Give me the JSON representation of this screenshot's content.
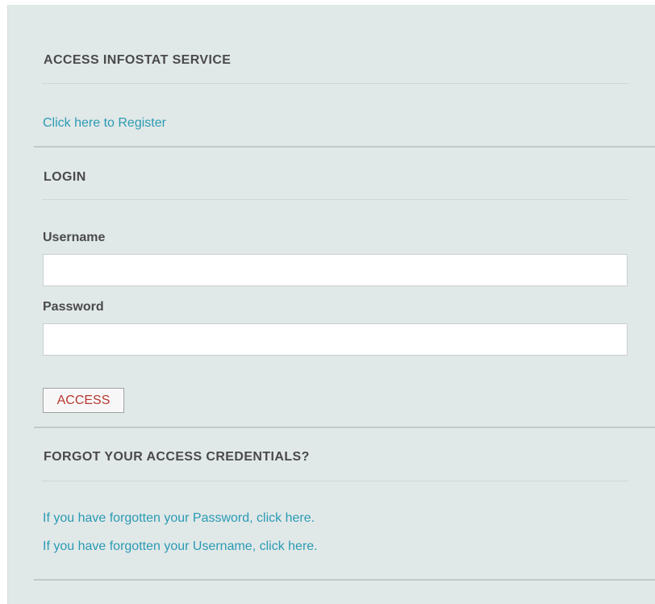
{
  "service_section": {
    "title": "ACCESS INFOSTAT SERVICE",
    "register_link": "Click here to Register"
  },
  "login_section": {
    "title": "LOGIN",
    "username_label": "Username",
    "username_value": "",
    "password_label": "Password",
    "password_value": "",
    "access_button": "ACCESS"
  },
  "forgot_section": {
    "title": "FORGOT YOUR ACCESS CREDENTIALS?",
    "password_link": "If you have forgotten your Password, click here.",
    "username_link": "If you have forgotten your Username, click here."
  },
  "colors": {
    "panel_background": "#e1e8e8",
    "link": "#2a9bb3",
    "button_text": "#b9372f",
    "heading_text": "#4a4a4a"
  }
}
